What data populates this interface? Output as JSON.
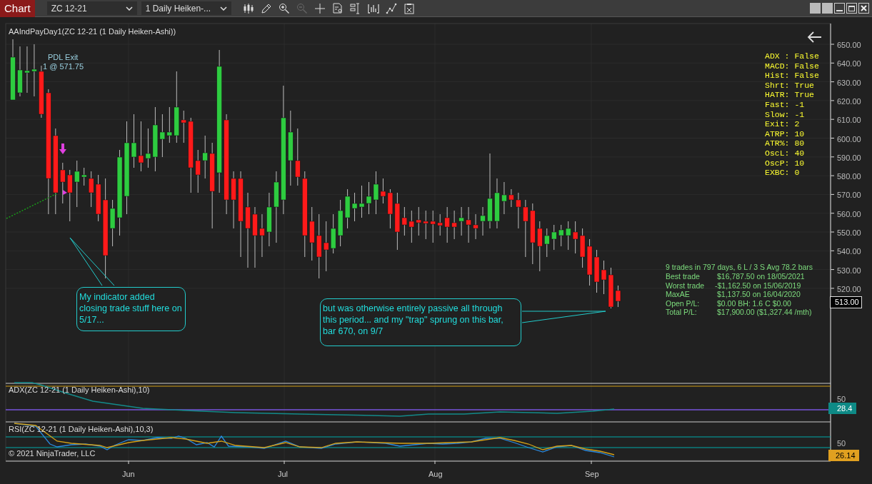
{
  "toolbar": {
    "chart_button": "Chart",
    "instrument": "ZC 12-21",
    "period": "1 Daily Heiken-...",
    "tools": [
      {
        "kind": "candles",
        "disabled": false
      },
      {
        "kind": "pencil",
        "disabled": false
      },
      {
        "kind": "zoom-in",
        "disabled": false
      },
      {
        "kind": "zoom-out",
        "disabled": true
      },
      {
        "kind": "crosshair",
        "disabled": false
      },
      {
        "kind": "doc-search",
        "disabled": false
      },
      {
        "kind": "properties",
        "disabled": false
      },
      {
        "kind": "bars",
        "disabled": false
      },
      {
        "kind": "line",
        "disabled": false
      },
      {
        "kind": "clipboard",
        "disabled": false
      }
    ]
  },
  "price_panel": {
    "title": "AAIndPayDay1(ZC 12-21 (1 Daily Heiken-Ashi))",
    "exit_label": "PDL Exit",
    "exit_detail": "1 @ 571.75",
    "y_axis": [
      "650.00",
      "640.00",
      "630.00",
      "620.00",
      "610.00",
      "600.00",
      "590.00",
      "580.00",
      "570.00",
      "560.00",
      "550.00",
      "540.00",
      "530.00",
      "520.00"
    ],
    "current_price": "513.00",
    "settings": [
      "ADX : False",
      "MACD: False",
      "Hist: False",
      "Shrt: True",
      "HATR: True",
      "Fast: -1",
      "Slow: -1",
      "Exit: 2",
      "ATRP: 10",
      "ATR%: 80",
      "OscL: 40",
      "OscP: 10",
      "EXBC: 0"
    ],
    "stats_summary": "9 trades in 797 days, 6 L / 3 S  Avg 78.2 bars",
    "stats": [
      {
        "label": "Best trade",
        "value": "$16,787.50 on 18/05/2021"
      },
      {
        "label": "Worst trade",
        "value": "-$1,162.50 on 15/06/2019"
      },
      {
        "label": "MaxAE",
        "value": "$1,137.50 on 16/04/2020"
      },
      {
        "label": "Open P/L:",
        "value": "$0.00 BH: 1.6 C $0.00"
      },
      {
        "label": "Total P/L:",
        "value": "$17,900.00 ($1,327.44 /mth)"
      }
    ],
    "callouts": [
      "My indicator added closing trade stuff here on 5/17...",
      "but was otherwise entirely passive all through this period... and my \"trap\" sprung on this bar, bar 670, on 9/7"
    ]
  },
  "adx_panel": {
    "title": "ADX(ZC 12-21 (1 Daily Heiken-Ashi),10)",
    "axis_label": "50",
    "value": "28.4"
  },
  "rsi_panel": {
    "title": "RSI(ZC 12-21 (1 Daily Heiken-Ashi),10,3)",
    "copyright": "© 2021 NinjaTrader, LLC",
    "axis_label": "50",
    "value": "26.14"
  },
  "x_axis": [
    "Jun",
    "Jul",
    "Aug",
    "Sep"
  ]
}
